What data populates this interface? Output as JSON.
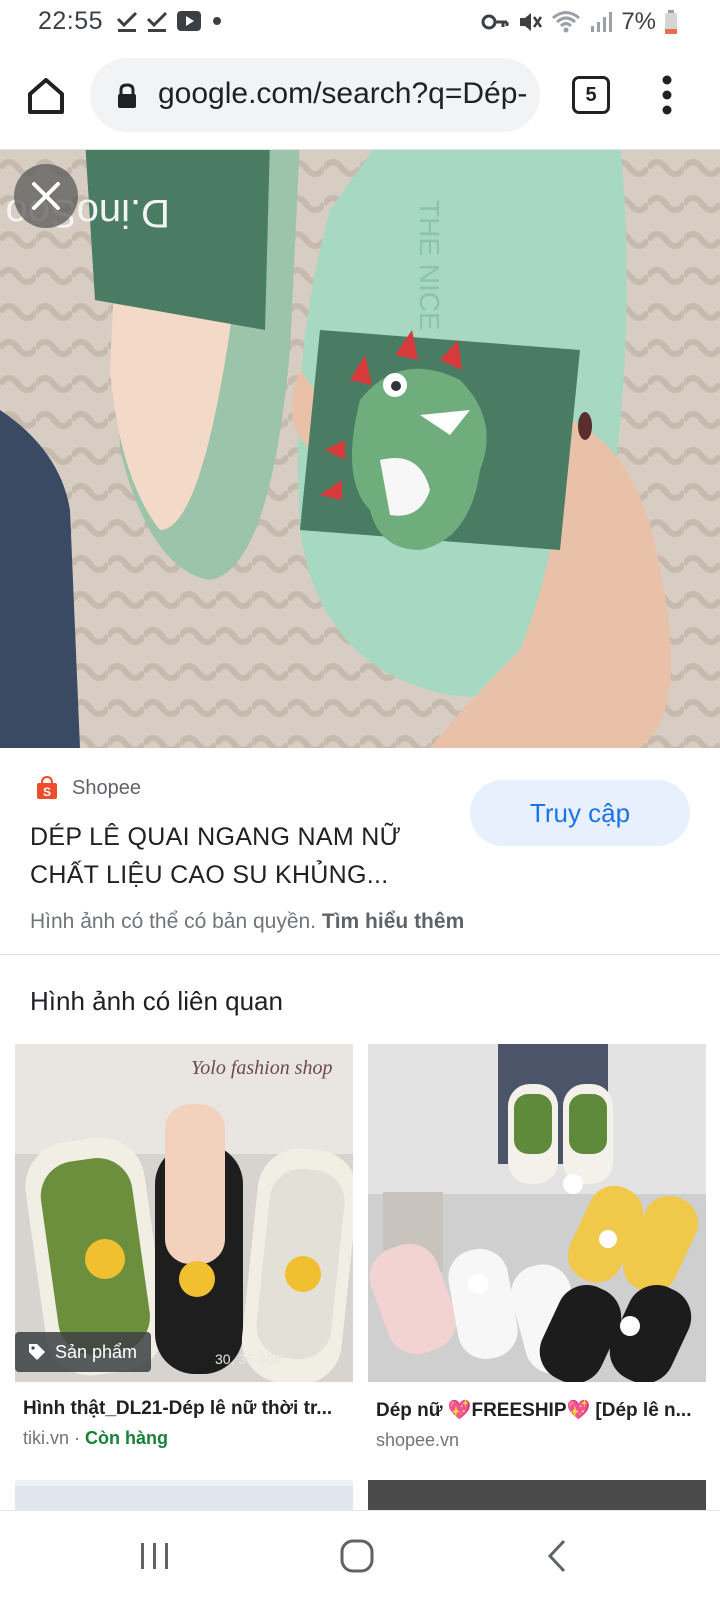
{
  "status": {
    "time": "22:55",
    "battery": "7%"
  },
  "browser": {
    "url": "google.com/search?q=Dép-",
    "tab_count": "5"
  },
  "result": {
    "source": "Shopee",
    "title_line1": "DÉP LÊ QUAI NGANG NAM NỮ",
    "title_line2": "CHẤT LIỆU CAO SU KHỦNG...",
    "visit_label": "Truy cập",
    "copyright_text": "Hình ảnh có thể có bản quyền.",
    "learn_more": "Tìm hiểu thêm"
  },
  "related": {
    "heading": "Hình ảnh có liên quan",
    "items": [
      {
        "title": "Hình thật_DL21-Dép lê nữ thời tr...",
        "source": "tiki.vn",
        "separator": " · ",
        "stock": "Còn hàng",
        "badge": "Sản phẩm",
        "watermark": "Yolo fashion shop",
        "size_text": "30, 36-40#"
      },
      {
        "title": "Dép nữ 💖FREESHIP💖 [Dép lê n...",
        "source": "shopee.vn"
      }
    ]
  },
  "hero": {
    "brand_text": "D.inoSoo",
    "side_text": "THE NICE"
  },
  "colors": {
    "accent": "#1a73e8",
    "visit_bg": "#e8f0fe",
    "stock_green": "#188038",
    "shopee_orange": "#ee4d2d"
  }
}
